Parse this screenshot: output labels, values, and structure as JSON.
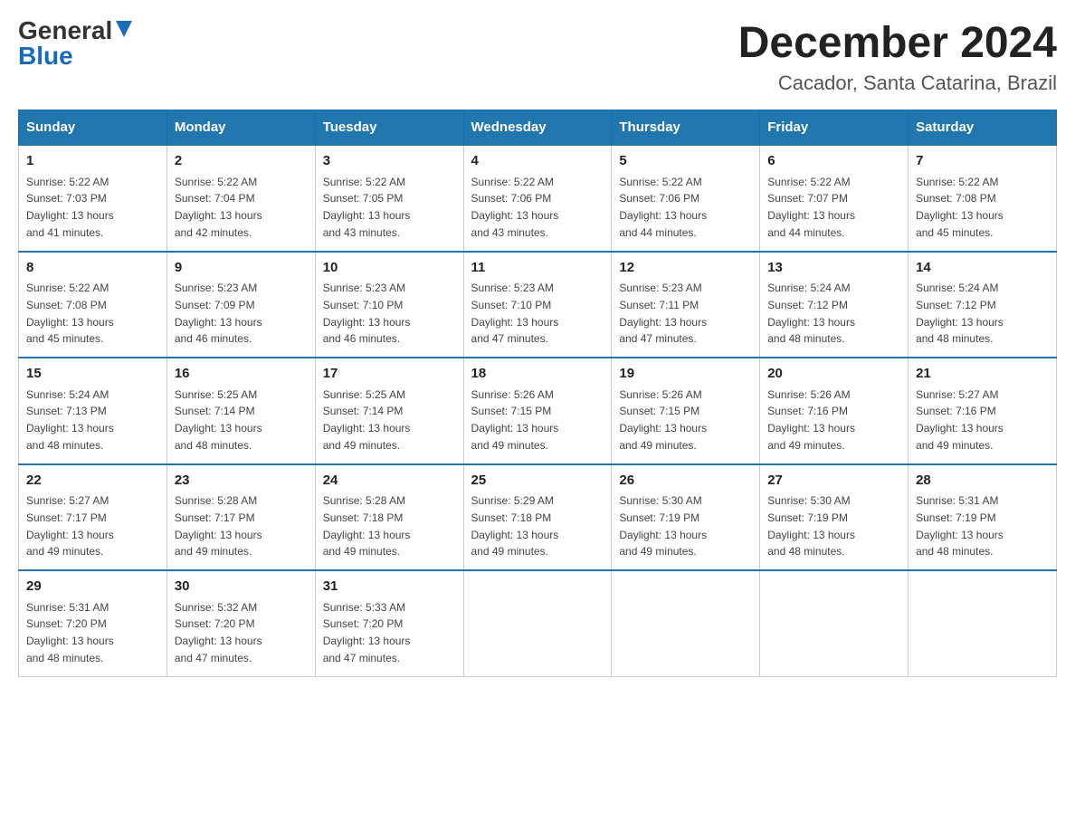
{
  "header": {
    "logo_general": "General",
    "logo_blue": "Blue",
    "month_title": "December 2024",
    "location": "Cacador, Santa Catarina, Brazil"
  },
  "weekdays": [
    "Sunday",
    "Monday",
    "Tuesday",
    "Wednesday",
    "Thursday",
    "Friday",
    "Saturday"
  ],
  "weeks": [
    [
      {
        "day": "1",
        "sunrise": "5:22 AM",
        "sunset": "7:03 PM",
        "daylight": "13 hours and 41 minutes."
      },
      {
        "day": "2",
        "sunrise": "5:22 AM",
        "sunset": "7:04 PM",
        "daylight": "13 hours and 42 minutes."
      },
      {
        "day": "3",
        "sunrise": "5:22 AM",
        "sunset": "7:05 PM",
        "daylight": "13 hours and 43 minutes."
      },
      {
        "day": "4",
        "sunrise": "5:22 AM",
        "sunset": "7:06 PM",
        "daylight": "13 hours and 43 minutes."
      },
      {
        "day": "5",
        "sunrise": "5:22 AM",
        "sunset": "7:06 PM",
        "daylight": "13 hours and 44 minutes."
      },
      {
        "day": "6",
        "sunrise": "5:22 AM",
        "sunset": "7:07 PM",
        "daylight": "13 hours and 44 minutes."
      },
      {
        "day": "7",
        "sunrise": "5:22 AM",
        "sunset": "7:08 PM",
        "daylight": "13 hours and 45 minutes."
      }
    ],
    [
      {
        "day": "8",
        "sunrise": "5:22 AM",
        "sunset": "7:08 PM",
        "daylight": "13 hours and 45 minutes."
      },
      {
        "day": "9",
        "sunrise": "5:23 AM",
        "sunset": "7:09 PM",
        "daylight": "13 hours and 46 minutes."
      },
      {
        "day": "10",
        "sunrise": "5:23 AM",
        "sunset": "7:10 PM",
        "daylight": "13 hours and 46 minutes."
      },
      {
        "day": "11",
        "sunrise": "5:23 AM",
        "sunset": "7:10 PM",
        "daylight": "13 hours and 47 minutes."
      },
      {
        "day": "12",
        "sunrise": "5:23 AM",
        "sunset": "7:11 PM",
        "daylight": "13 hours and 47 minutes."
      },
      {
        "day": "13",
        "sunrise": "5:24 AM",
        "sunset": "7:12 PM",
        "daylight": "13 hours and 48 minutes."
      },
      {
        "day": "14",
        "sunrise": "5:24 AM",
        "sunset": "7:12 PM",
        "daylight": "13 hours and 48 minutes."
      }
    ],
    [
      {
        "day": "15",
        "sunrise": "5:24 AM",
        "sunset": "7:13 PM",
        "daylight": "13 hours and 48 minutes."
      },
      {
        "day": "16",
        "sunrise": "5:25 AM",
        "sunset": "7:14 PM",
        "daylight": "13 hours and 48 minutes."
      },
      {
        "day": "17",
        "sunrise": "5:25 AM",
        "sunset": "7:14 PM",
        "daylight": "13 hours and 49 minutes."
      },
      {
        "day": "18",
        "sunrise": "5:26 AM",
        "sunset": "7:15 PM",
        "daylight": "13 hours and 49 minutes."
      },
      {
        "day": "19",
        "sunrise": "5:26 AM",
        "sunset": "7:15 PM",
        "daylight": "13 hours and 49 minutes."
      },
      {
        "day": "20",
        "sunrise": "5:26 AM",
        "sunset": "7:16 PM",
        "daylight": "13 hours and 49 minutes."
      },
      {
        "day": "21",
        "sunrise": "5:27 AM",
        "sunset": "7:16 PM",
        "daylight": "13 hours and 49 minutes."
      }
    ],
    [
      {
        "day": "22",
        "sunrise": "5:27 AM",
        "sunset": "7:17 PM",
        "daylight": "13 hours and 49 minutes."
      },
      {
        "day": "23",
        "sunrise": "5:28 AM",
        "sunset": "7:17 PM",
        "daylight": "13 hours and 49 minutes."
      },
      {
        "day": "24",
        "sunrise": "5:28 AM",
        "sunset": "7:18 PM",
        "daylight": "13 hours and 49 minutes."
      },
      {
        "day": "25",
        "sunrise": "5:29 AM",
        "sunset": "7:18 PM",
        "daylight": "13 hours and 49 minutes."
      },
      {
        "day": "26",
        "sunrise": "5:30 AM",
        "sunset": "7:19 PM",
        "daylight": "13 hours and 49 minutes."
      },
      {
        "day": "27",
        "sunrise": "5:30 AM",
        "sunset": "7:19 PM",
        "daylight": "13 hours and 48 minutes."
      },
      {
        "day": "28",
        "sunrise": "5:31 AM",
        "sunset": "7:19 PM",
        "daylight": "13 hours and 48 minutes."
      }
    ],
    [
      {
        "day": "29",
        "sunrise": "5:31 AM",
        "sunset": "7:20 PM",
        "daylight": "13 hours and 48 minutes."
      },
      {
        "day": "30",
        "sunrise": "5:32 AM",
        "sunset": "7:20 PM",
        "daylight": "13 hours and 47 minutes."
      },
      {
        "day": "31",
        "sunrise": "5:33 AM",
        "sunset": "7:20 PM",
        "daylight": "13 hours and 47 minutes."
      },
      null,
      null,
      null,
      null
    ]
  ],
  "labels": {
    "sunrise": "Sunrise:",
    "sunset": "Sunset:",
    "daylight": "Daylight:"
  }
}
